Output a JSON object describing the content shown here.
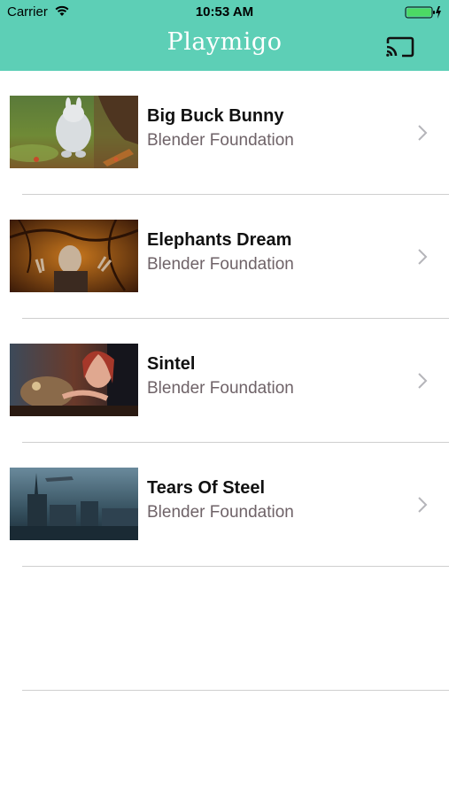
{
  "status_bar": {
    "carrier": "Carrier",
    "time": "10:53 AM"
  },
  "nav": {
    "title": "Playmigo",
    "cast_icon": "cast-icon"
  },
  "videos": [
    {
      "title": "Big Buck Bunny",
      "subtitle": "Blender Foundation"
    },
    {
      "title": "Elephants Dream",
      "subtitle": "Blender Foundation"
    },
    {
      "title": "Sintel",
      "subtitle": "Blender Foundation"
    },
    {
      "title": "Tears Of Steel",
      "subtitle": "Blender Foundation"
    }
  ],
  "colors": {
    "header": "#5dcfb6",
    "title_text": "#ffffff",
    "subtitle_text": "#6f6368",
    "battery": "#4cd964"
  }
}
